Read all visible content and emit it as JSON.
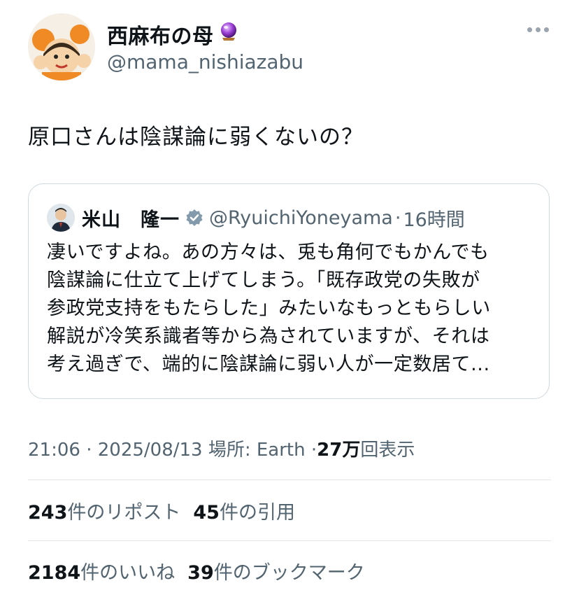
{
  "author": {
    "display_name": "西麻布の母",
    "emoji": "🔮",
    "handle": "@mama_nishiazabu"
  },
  "tweet": {
    "text": "原口さんは陰謀論に弱くないの？"
  },
  "quoted": {
    "name": "米山　隆一",
    "handle": "@RyuichiYoneyama",
    "separator": "·",
    "time": "16時間",
    "text": "凄いですよね。あの方々は、兎も角何でもかんでも\n陰謀論に仕立て上げてしまう。「既存政党の失敗が\n参政党支持をもたらした」みたいなもっともらしい\n解説が冷笑系識者等から為されていますが、それは\n考え過ぎで、端的に陰謀論に弱い人が一定数居て..."
  },
  "meta": {
    "time": "21:06",
    "sep1": "·",
    "date": "2025/08/13",
    "location_label": "場所: Earth",
    "sep2": "·",
    "views_count": "27万",
    "views_label": "回表示"
  },
  "stats": {
    "reposts_count": "243",
    "reposts_label": "件のリポスト",
    "quotes_count": "45",
    "quotes_label": "件の引用",
    "likes_count": "2184",
    "likes_label": "件のいいね",
    "bookmarks_count": "39",
    "bookmarks_label": "件のブックマーク"
  },
  "colors": {
    "text": "#0f1419",
    "secondary": "#536471",
    "border": "#cfd9de",
    "verified": "#829aab"
  },
  "icons": [
    "more-icon",
    "verified-badge-icon",
    "crystal-ball-emoji"
  ]
}
